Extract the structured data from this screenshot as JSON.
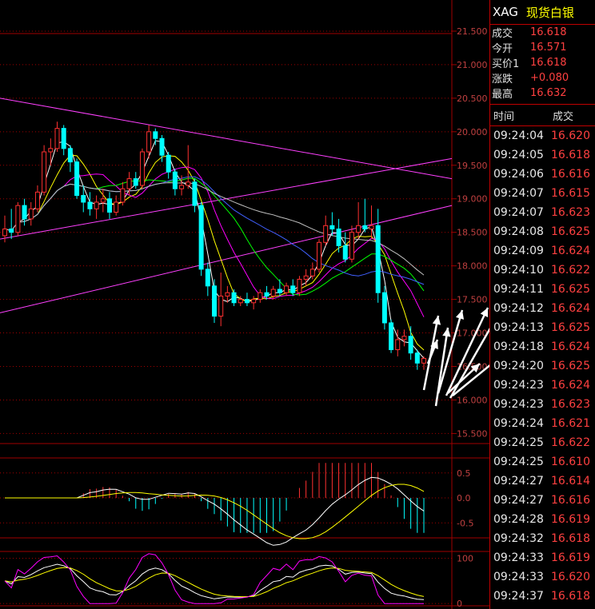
{
  "quote_panel": {
    "symbol": "XAG",
    "name": "现货白银",
    "rows": [
      {
        "label": "成交",
        "value": "16.618"
      },
      {
        "label": "今开",
        "value": "16.571"
      },
      {
        "label": "买价1",
        "value": "16.618"
      },
      {
        "label": "涨跌",
        "value": "+0.080"
      },
      {
        "label": "最高",
        "value": "16.632"
      }
    ],
    "ticks_header": {
      "time": "时间",
      "price": "成交"
    },
    "ticks": [
      {
        "time": "09:24:04",
        "price": "16.620"
      },
      {
        "time": "09:24:05",
        "price": "16.618"
      },
      {
        "time": "09:24:06",
        "price": "16.616"
      },
      {
        "time": "09:24:07",
        "price": "16.615"
      },
      {
        "time": "09:24:07",
        "price": "16.623"
      },
      {
        "time": "09:24:08",
        "price": "16.625"
      },
      {
        "time": "09:24:09",
        "price": "16.624"
      },
      {
        "time": "09:24:10",
        "price": "16.622"
      },
      {
        "time": "09:24:11",
        "price": "16.625"
      },
      {
        "time": "09:24:12",
        "price": "16.624"
      },
      {
        "time": "09:24:13",
        "price": "16.625"
      },
      {
        "time": "09:24:18",
        "price": "16.624"
      },
      {
        "time": "09:24:20",
        "price": "16.625"
      },
      {
        "time": "09:24:23",
        "price": "16.624"
      },
      {
        "time": "09:24:23",
        "price": "16.623"
      },
      {
        "time": "09:24:24",
        "price": "16.621"
      },
      {
        "time": "09:24:25",
        "price": "16.622"
      },
      {
        "time": "09:24:25",
        "price": "16.610"
      },
      {
        "time": "09:24:27",
        "price": "16.614"
      },
      {
        "time": "09:24:27",
        "price": "16.616"
      },
      {
        "time": "09:24:28",
        "price": "16.619"
      },
      {
        "time": "09:24:32",
        "price": "16.618"
      },
      {
        "time": "09:24:33",
        "price": "16.619"
      },
      {
        "time": "09:24:33",
        "price": "16.620"
      },
      {
        "time": "09:24:37",
        "price": "16.618"
      }
    ]
  },
  "colors": {
    "up": "#ff3030",
    "down": "#00ffff",
    "ma1": "#ffffff",
    "ma2": "#ffff00",
    "ma3": "#ff00ff",
    "ma4": "#00ff00",
    "ma5": "#4060ff",
    "ma6": "#c0c0c0",
    "trendline": "#ff40ff",
    "grid": "#a00000",
    "axis_text": "#c04040"
  },
  "chart_data": [
    {
      "type": "candlestick",
      "y_tick_labels": [
        "21.500",
        "21.000",
        "20.500",
        "20.000",
        "19.500",
        "19.000",
        "18.500",
        "18.000",
        "17.500",
        "17.000",
        "16.500",
        "16.000",
        "15.500"
      ],
      "ylim": [
        15.35,
        21.75
      ],
      "candles": [
        {
          "o": 18.45,
          "h": 18.75,
          "l": 18.35,
          "c": 18.55
        },
        {
          "o": 18.55,
          "h": 18.85,
          "l": 18.4,
          "c": 18.5
        },
        {
          "o": 18.5,
          "h": 18.95,
          "l": 18.45,
          "c": 18.9
        },
        {
          "o": 18.9,
          "h": 19.0,
          "l": 18.6,
          "c": 18.7
        },
        {
          "o": 18.7,
          "h": 18.95,
          "l": 18.6,
          "c": 18.85
        },
        {
          "o": 18.85,
          "h": 19.2,
          "l": 18.8,
          "c": 19.1
        },
        {
          "o": 19.1,
          "h": 19.8,
          "l": 19.05,
          "c": 19.7
        },
        {
          "o": 19.7,
          "h": 19.9,
          "l": 19.5,
          "c": 19.75
        },
        {
          "o": 19.75,
          "h": 20.15,
          "l": 19.7,
          "c": 20.05
        },
        {
          "o": 20.05,
          "h": 20.1,
          "l": 19.65,
          "c": 19.75
        },
        {
          "o": 19.75,
          "h": 19.8,
          "l": 19.4,
          "c": 19.55
        },
        {
          "o": 19.55,
          "h": 19.6,
          "l": 19.0,
          "c": 19.05
        },
        {
          "o": 19.05,
          "h": 19.2,
          "l": 18.8,
          "c": 18.95
        },
        {
          "o": 18.95,
          "h": 19.1,
          "l": 18.75,
          "c": 18.85
        },
        {
          "o": 18.85,
          "h": 19.05,
          "l": 18.7,
          "c": 18.95
        },
        {
          "o": 18.95,
          "h": 19.15,
          "l": 18.8,
          "c": 19.0
        },
        {
          "o": 19.0,
          "h": 19.1,
          "l": 18.7,
          "c": 18.8
        },
        {
          "o": 18.8,
          "h": 19.05,
          "l": 18.75,
          "c": 18.95
        },
        {
          "o": 18.95,
          "h": 19.25,
          "l": 18.9,
          "c": 19.15
        },
        {
          "o": 19.15,
          "h": 19.4,
          "l": 19.05,
          "c": 19.3
        },
        {
          "o": 19.3,
          "h": 19.4,
          "l": 19.15,
          "c": 19.2
        },
        {
          "o": 19.2,
          "h": 19.75,
          "l": 19.15,
          "c": 19.7
        },
        {
          "o": 19.7,
          "h": 20.1,
          "l": 19.6,
          "c": 20.0
        },
        {
          "o": 20.0,
          "h": 20.05,
          "l": 19.8,
          "c": 19.9
        },
        {
          "o": 19.9,
          "h": 19.95,
          "l": 19.55,
          "c": 19.65
        },
        {
          "o": 19.65,
          "h": 19.7,
          "l": 19.3,
          "c": 19.4
        },
        {
          "o": 19.4,
          "h": 19.45,
          "l": 19.05,
          "c": 19.15
        },
        {
          "o": 19.15,
          "h": 19.35,
          "l": 19.05,
          "c": 19.2
        },
        {
          "o": 19.2,
          "h": 19.8,
          "l": 19.15,
          "c": 19.25
        },
        {
          "o": 19.25,
          "h": 19.3,
          "l": 18.8,
          "c": 18.9
        },
        {
          "o": 18.9,
          "h": 18.95,
          "l": 17.85,
          "c": 17.95
        },
        {
          "o": 17.95,
          "h": 18.05,
          "l": 17.55,
          "c": 17.7
        },
        {
          "o": 17.7,
          "h": 17.8,
          "l": 17.15,
          "c": 17.25
        },
        {
          "o": 17.25,
          "h": 17.9,
          "l": 17.1,
          "c": 17.55
        },
        {
          "o": 17.55,
          "h": 17.7,
          "l": 17.45,
          "c": 17.6
        },
        {
          "o": 17.6,
          "h": 17.65,
          "l": 17.4,
          "c": 17.45
        },
        {
          "o": 17.45,
          "h": 17.55,
          "l": 17.4,
          "c": 17.5
        },
        {
          "o": 17.5,
          "h": 17.6,
          "l": 17.4,
          "c": 17.45
        },
        {
          "o": 17.45,
          "h": 17.55,
          "l": 17.35,
          "c": 17.5
        },
        {
          "o": 17.5,
          "h": 17.65,
          "l": 17.45,
          "c": 17.6
        },
        {
          "o": 17.6,
          "h": 17.7,
          "l": 17.5,
          "c": 17.55
        },
        {
          "o": 17.55,
          "h": 17.7,
          "l": 17.5,
          "c": 17.65
        },
        {
          "o": 17.65,
          "h": 17.8,
          "l": 17.55,
          "c": 17.6
        },
        {
          "o": 17.6,
          "h": 17.75,
          "l": 17.55,
          "c": 17.7
        },
        {
          "o": 17.7,
          "h": 17.8,
          "l": 17.55,
          "c": 17.6
        },
        {
          "o": 17.6,
          "h": 17.85,
          "l": 17.55,
          "c": 17.8
        },
        {
          "o": 17.8,
          "h": 17.95,
          "l": 17.7,
          "c": 17.85
        },
        {
          "o": 17.85,
          "h": 18.05,
          "l": 17.8,
          "c": 17.95
        },
        {
          "o": 17.95,
          "h": 18.4,
          "l": 17.9,
          "c": 18.35
        },
        {
          "o": 18.35,
          "h": 18.75,
          "l": 18.3,
          "c": 18.6
        },
        {
          "o": 18.6,
          "h": 18.8,
          "l": 18.45,
          "c": 18.55
        },
        {
          "o": 18.55,
          "h": 18.7,
          "l": 18.2,
          "c": 18.3
        },
        {
          "o": 18.3,
          "h": 18.5,
          "l": 18.05,
          "c": 18.1
        },
        {
          "o": 18.1,
          "h": 18.6,
          "l": 18.05,
          "c": 18.5
        },
        {
          "o": 18.5,
          "h": 18.95,
          "l": 18.4,
          "c": 18.6
        },
        {
          "o": 18.6,
          "h": 19.0,
          "l": 18.5,
          "c": 18.55
        },
        {
          "o": 18.55,
          "h": 18.9,
          "l": 18.4,
          "c": 18.6
        },
        {
          "o": 18.6,
          "h": 18.85,
          "l": 17.45,
          "c": 17.6
        },
        {
          "o": 17.6,
          "h": 17.7,
          "l": 17.05,
          "c": 17.15
        },
        {
          "o": 17.15,
          "h": 17.2,
          "l": 16.7,
          "c": 16.75
        },
        {
          "o": 16.75,
          "h": 17.05,
          "l": 16.65,
          "c": 16.9
        },
        {
          "o": 16.9,
          "h": 17.05,
          "l": 16.8,
          "c": 16.95
        },
        {
          "o": 16.95,
          "h": 17.1,
          "l": 16.6,
          "c": 16.7
        },
        {
          "o": 16.7,
          "h": 16.75,
          "l": 16.45,
          "c": 16.55
        },
        {
          "o": 16.55,
          "h": 16.65,
          "l": 16.45,
          "c": 16.62
        }
      ]
    },
    {
      "type": "bar",
      "y_tick_labels": [
        "0.5",
        "0.0",
        "-0.5"
      ],
      "ylim": [
        -0.8,
        0.8
      ]
    },
    {
      "type": "line",
      "y_tick_labels": [
        "100",
        "0"
      ],
      "ylim": [
        -5,
        115
      ]
    }
  ]
}
